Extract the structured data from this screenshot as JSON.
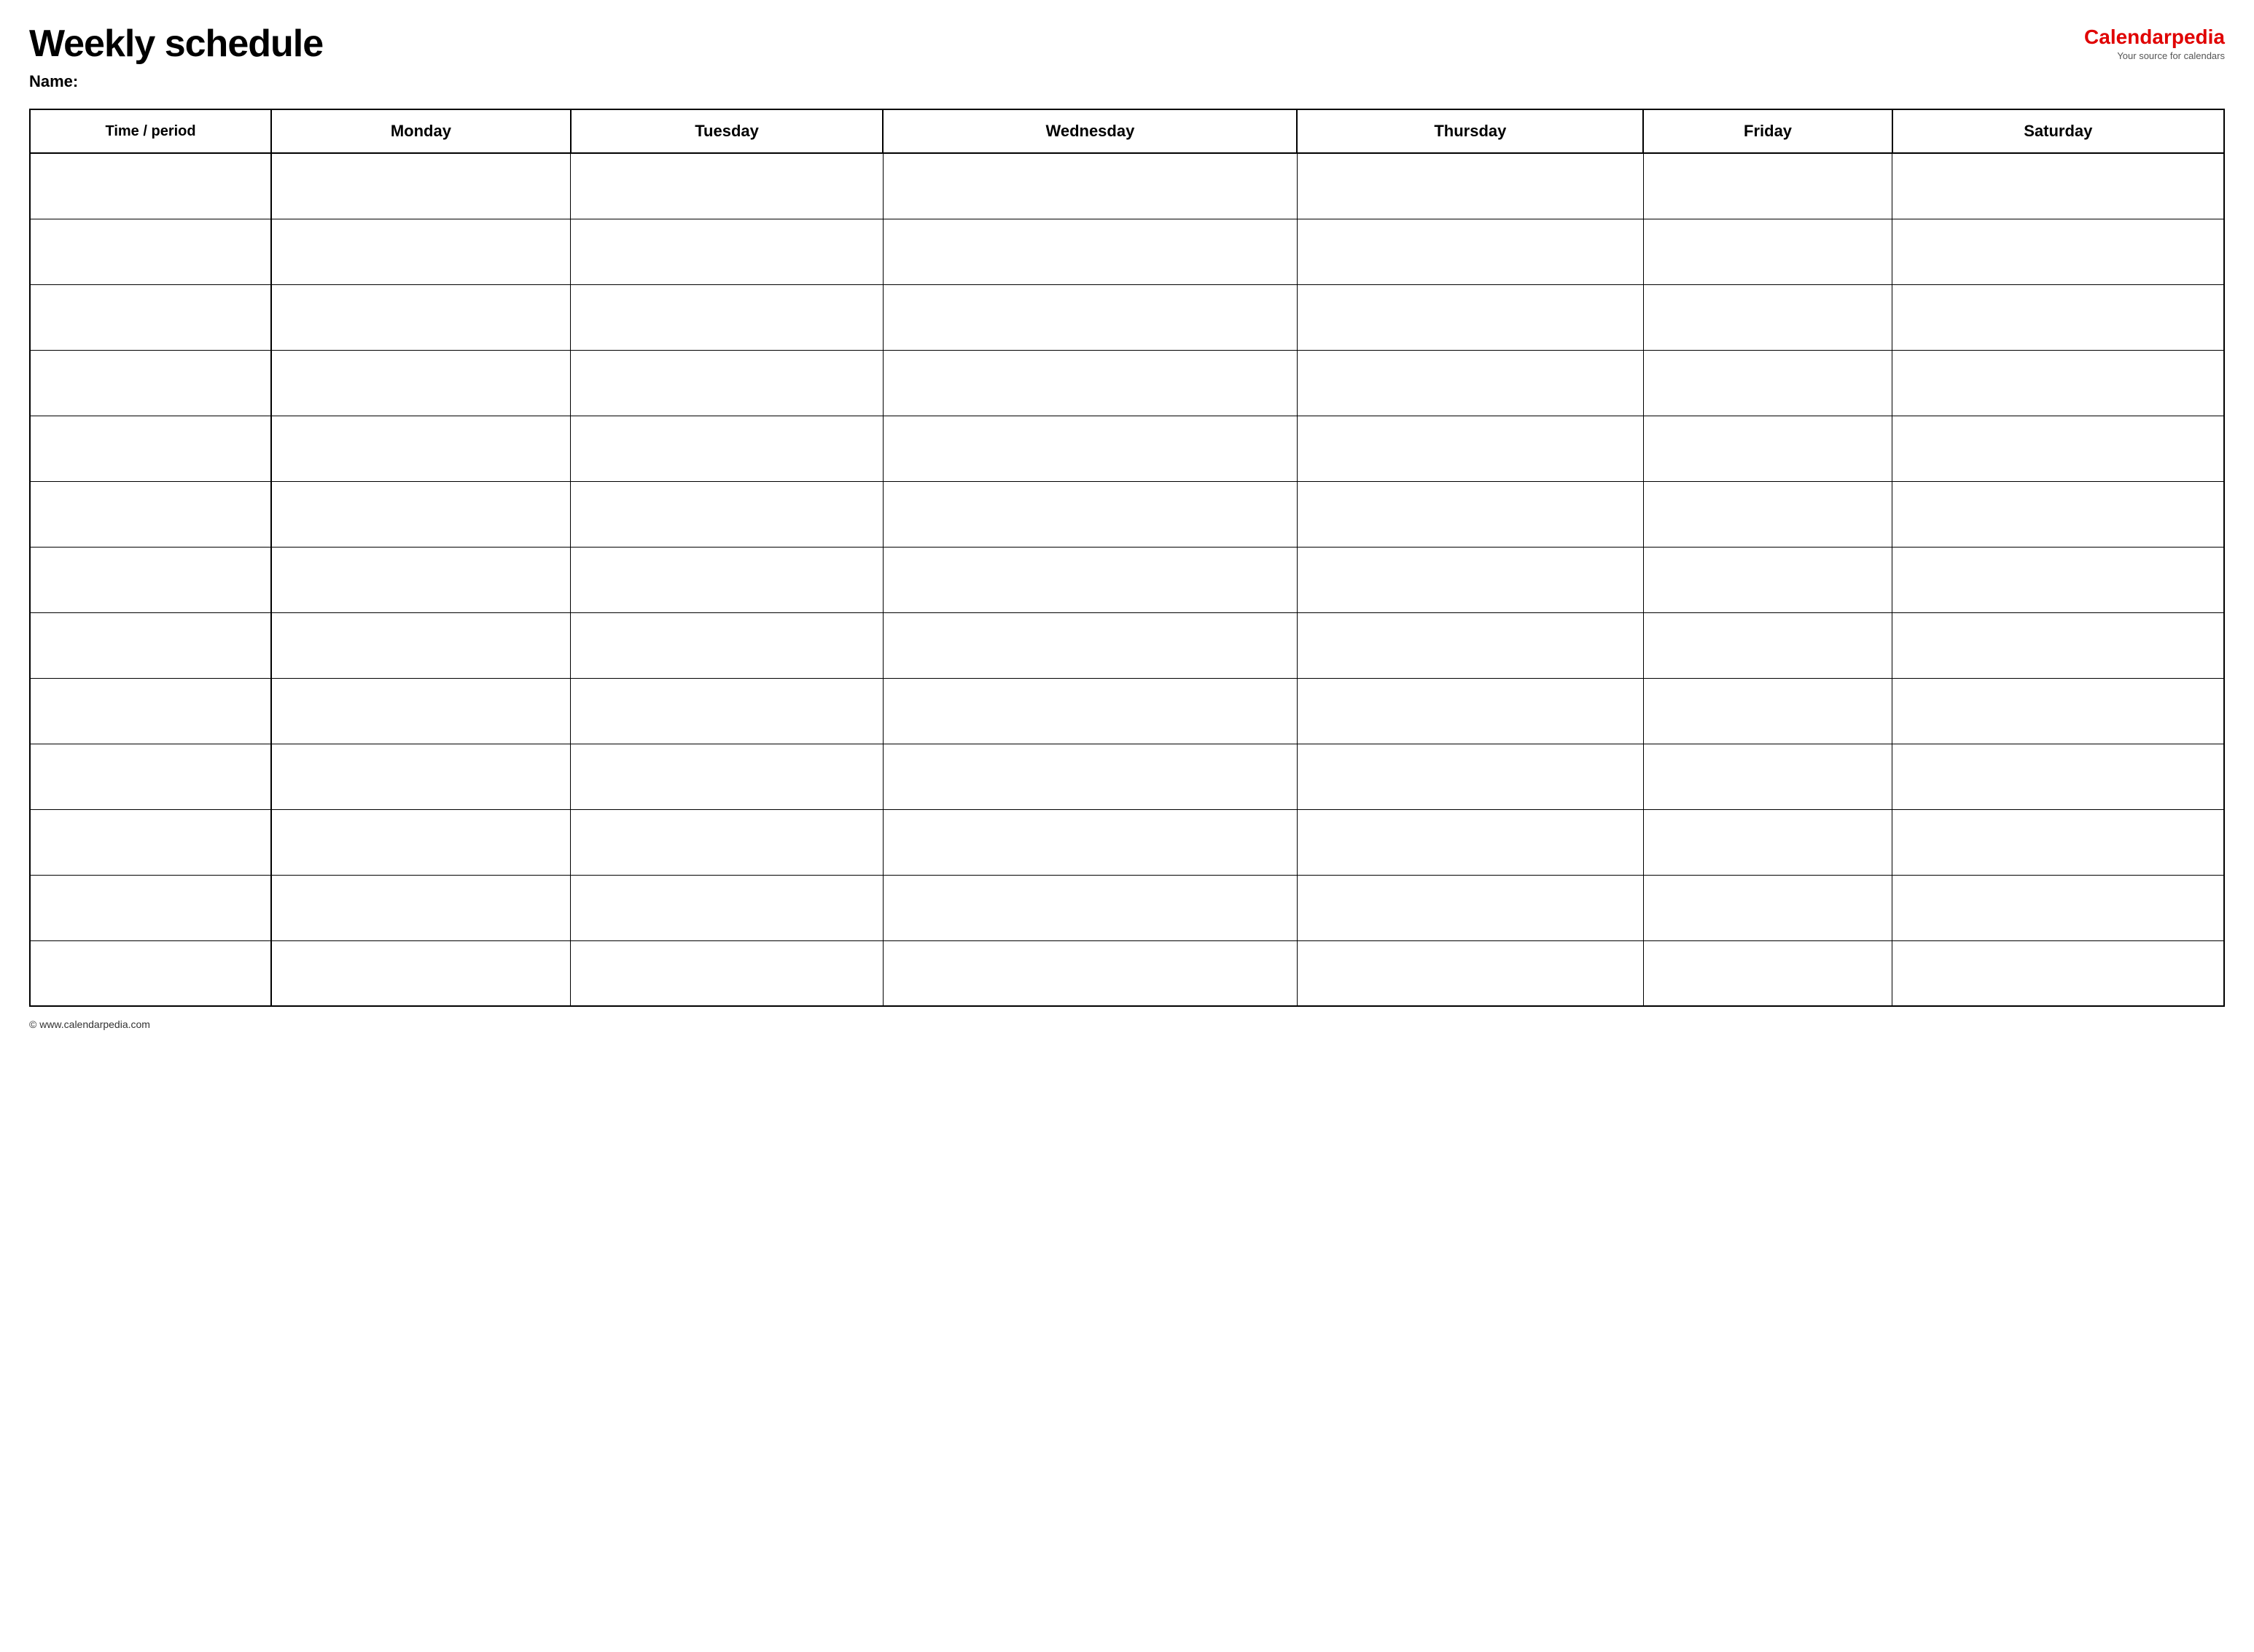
{
  "header": {
    "title": "Weekly schedule",
    "name_label": "Name:",
    "logo_brand": "Calendar",
    "logo_brand_red": "pedia",
    "logo_tagline": "Your source for calendars"
  },
  "table": {
    "columns": [
      {
        "id": "time",
        "label": "Time / period"
      },
      {
        "id": "monday",
        "label": "Monday"
      },
      {
        "id": "tuesday",
        "label": "Tuesday"
      },
      {
        "id": "wednesday",
        "label": "Wednesday"
      },
      {
        "id": "thursday",
        "label": "Thursday"
      },
      {
        "id": "friday",
        "label": "Friday"
      },
      {
        "id": "saturday",
        "label": "Saturday"
      }
    ],
    "row_count": 13
  },
  "footer": {
    "text": "© www.calendarpedia.com"
  }
}
